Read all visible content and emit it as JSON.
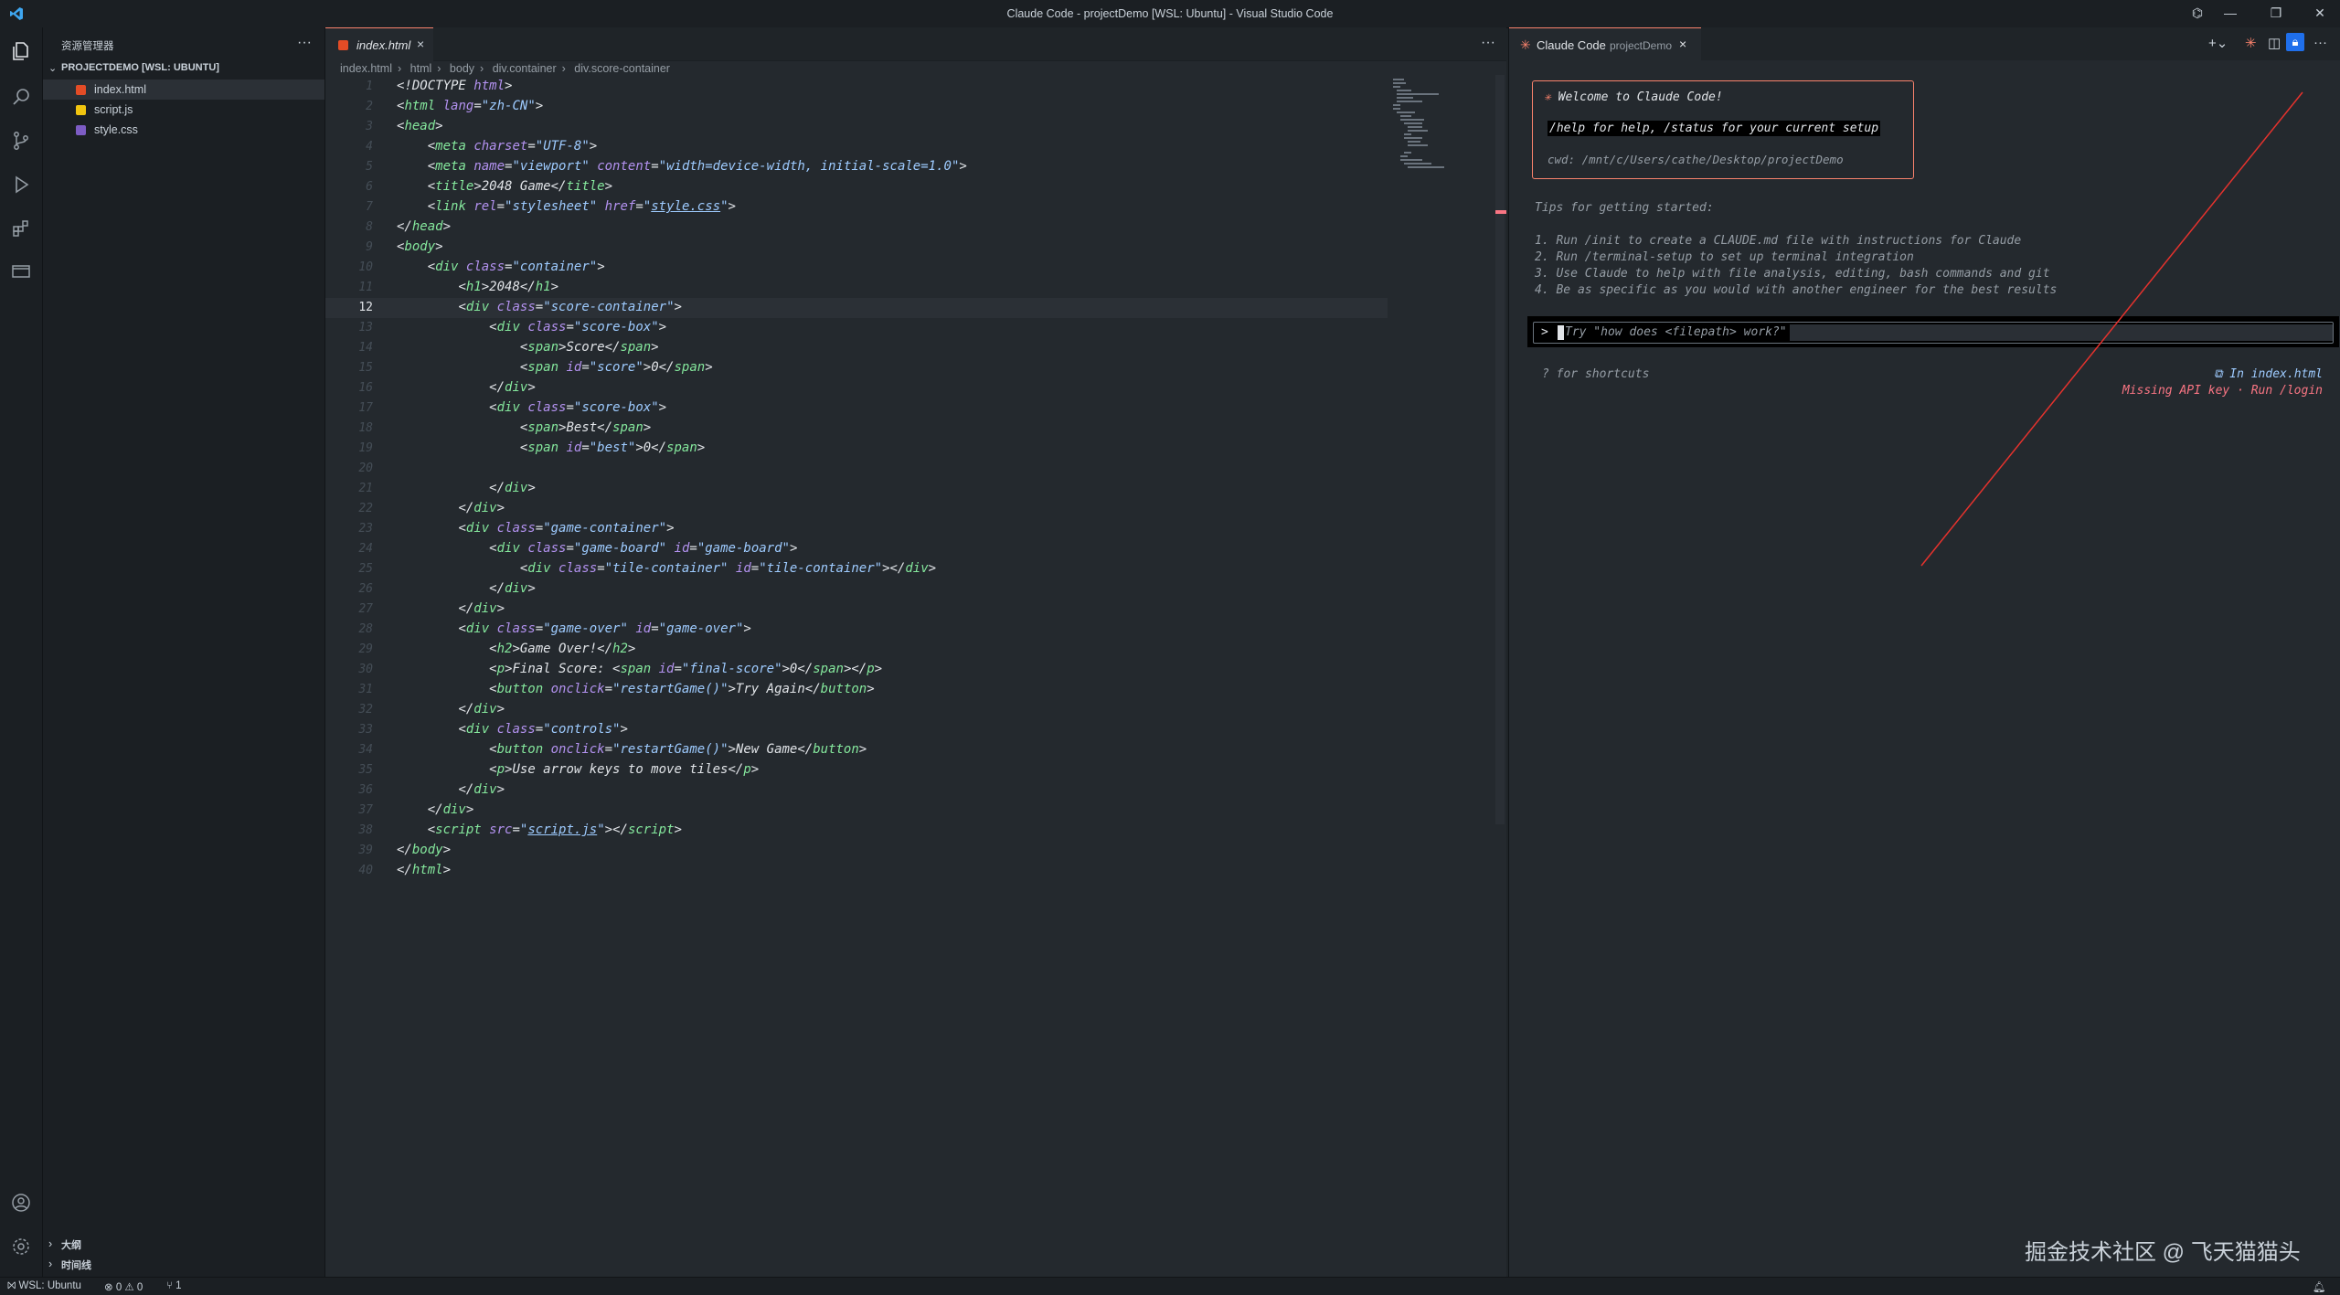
{
  "window": {
    "title": "Claude Code - projectDemo [WSL: Ubuntu] - Visual Studio Code"
  },
  "sidebar": {
    "header": "资源管理器",
    "project": "PROJECTDEMO [WSL: UBUNTU]",
    "files": [
      {
        "name": "index.html",
        "icon_color": "#e34c26"
      },
      {
        "name": "script.js",
        "icon_color": "#f1c40f"
      },
      {
        "name": "style.css",
        "icon_color": "#7d5cc4"
      }
    ],
    "bottom_sections": [
      "大纲",
      "时间线"
    ]
  },
  "editor": {
    "tab": "index.html",
    "breadcrumb": [
      "index.html",
      "html",
      "body",
      "div.container",
      "div.score-container"
    ],
    "current_line": 12
  },
  "panel": {
    "tab_title": "Claude Code",
    "tab_subtitle": "projectDemo",
    "welcome": "Welcome to Claude Code!",
    "help": "/help for help, /status for your current setup",
    "cwd": "cwd: /mnt/c/Users/cathe/Desktop/projectDemo",
    "tips_header": "Tips for getting started:",
    "tips": [
      "1. Run /init to create a CLAUDE.md file with instructions for Claude",
      "2. Run /terminal-setup to set up terminal integration",
      "3. Use Claude to help with file analysis, editing, bash commands and git",
      "4. Be as specific as you would with another engineer for the best results"
    ],
    "prompt_placeholder": "Try \"how does <filepath> work?\"",
    "shortcuts": "? for shortcuts",
    "in_file": "⧉ In index.html",
    "api_warning": "Missing API key · Run /login"
  },
  "statusbar": {
    "remote": "WSL: Ubuntu",
    "problems": "⊗ 0 ⚠ 0",
    "ports": "⑂ 1"
  },
  "watermark": "掘金技术社区 @ 飞天猫猫头",
  "colors": {
    "accent": "#f9826c",
    "warning": "#f97583"
  }
}
